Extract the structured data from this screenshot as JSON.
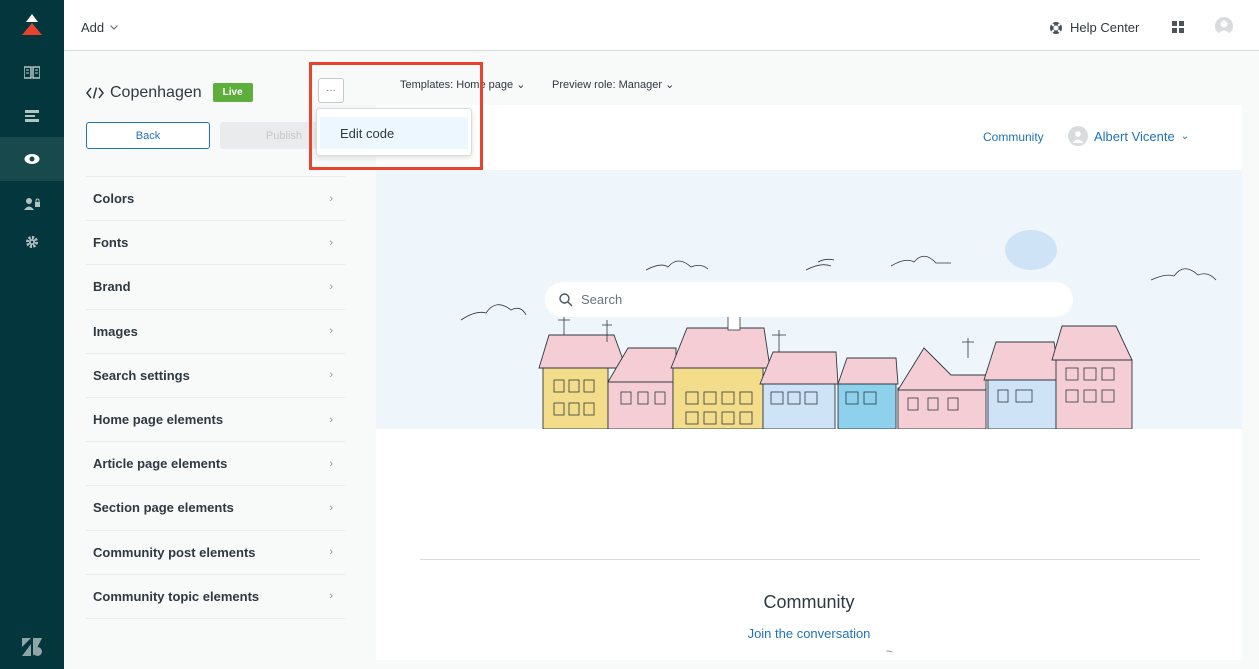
{
  "topbar": {
    "add_label": "Add",
    "help_center_label": "Help Center"
  },
  "theme": {
    "name": "Copenhagen",
    "status_badge": "Live",
    "more_label": "···",
    "back_label": "Back",
    "publish_label": "Publish"
  },
  "menu": {
    "edit_code_label": "Edit code"
  },
  "settings": {
    "items": [
      {
        "label": "Colors"
      },
      {
        "label": "Fonts"
      },
      {
        "label": "Brand"
      },
      {
        "label": "Images"
      },
      {
        "label": "Search settings"
      },
      {
        "label": "Home page elements"
      },
      {
        "label": "Article page elements"
      },
      {
        "label": "Section page elements"
      },
      {
        "label": "Community post elements"
      },
      {
        "label": "Community topic elements"
      }
    ]
  },
  "preview_controls": {
    "template_label": "Templates: Home page",
    "role_label": "Preview role: Manager"
  },
  "preview": {
    "community_link": "Community",
    "user_name": "Albert Vicente",
    "search_placeholder": "Search",
    "community_title": "Community",
    "community_subtitle": "Join the conversation",
    "tilde": "~"
  },
  "colors": {
    "rail": "#03363d",
    "accent": "#1f73b7",
    "live": "#5eae3b",
    "highlight": "#e8432d"
  }
}
